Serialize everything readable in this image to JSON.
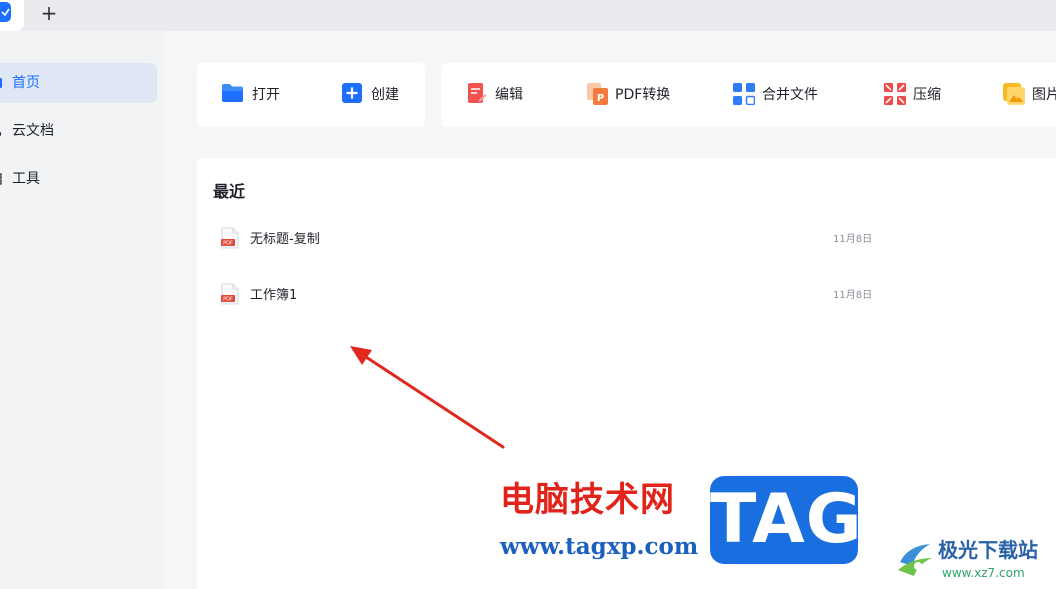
{
  "titlebar": {
    "new_tab_label": "+"
  },
  "sidebar": {
    "items": [
      {
        "label": "首页",
        "icon": "home-icon",
        "active": true
      },
      {
        "label": "云文档",
        "icon": "cloud-doc-icon",
        "active": false
      },
      {
        "label": "工具",
        "icon": "tools-icon",
        "active": false
      }
    ]
  },
  "quick_actions": {
    "open_label": "打开",
    "create_label": "创建"
  },
  "tools": [
    {
      "label": "编辑",
      "icon": "edit-icon"
    },
    {
      "label": "PDF转换",
      "icon": "pdf-convert-icon"
    },
    {
      "label": "合并文件",
      "icon": "merge-files-icon"
    },
    {
      "label": "压缩",
      "icon": "compress-icon"
    },
    {
      "label": "图片",
      "icon": "image-icon"
    }
  ],
  "recent": {
    "title": "最近",
    "files": [
      {
        "name": "无标题-复制",
        "date": "11月8日",
        "icon": "pdf-file-icon"
      },
      {
        "name": "工作簿1",
        "date": "11月8日",
        "icon": "pdf-file-icon"
      }
    ]
  },
  "watermark": {
    "site_cn": "电脑技术网",
    "site_url": "www.tagxp.com",
    "tag": "TAG",
    "site2_name": "极光下载站",
    "site2_url": "www.xz7.com"
  },
  "colors": {
    "accent": "#1e6fff",
    "arrow": "#e0281e",
    "edit_icon": "#f2534f",
    "convert_icon": "#f57a3d",
    "merge_icon": "#2f7cf6",
    "compress_icon": "#f04a4a",
    "image_icon": "#f7b924"
  }
}
